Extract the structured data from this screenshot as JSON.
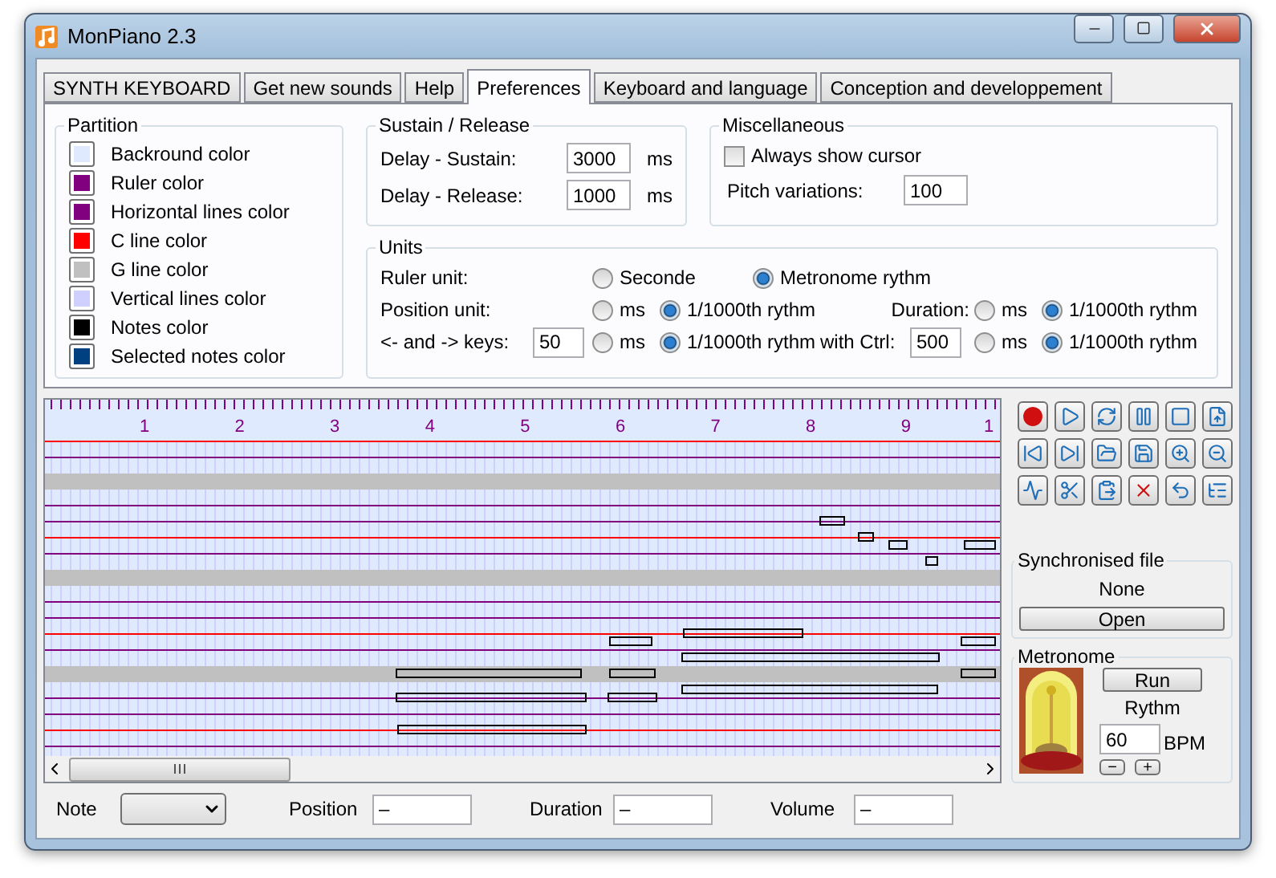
{
  "window": {
    "title": "MonPiano 2.3"
  },
  "tabs": [
    {
      "label": "SYNTH KEYBOARD",
      "selected": false
    },
    {
      "label": "Get new sounds",
      "selected": false
    },
    {
      "label": "Help",
      "selected": false
    },
    {
      "label": "Preferences",
      "selected": true
    },
    {
      "label": "Keyboard and language",
      "selected": false
    },
    {
      "label": "Conception and developpement",
      "selected": false
    }
  ],
  "partition": {
    "title": "Partition",
    "colors": [
      {
        "label": "Backround color",
        "color": "#e0eaff"
      },
      {
        "label": "Ruler color",
        "color": "#800080"
      },
      {
        "label": "Horizontal lines color",
        "color": "#800080"
      },
      {
        "label": "C line color",
        "color": "#ff0000"
      },
      {
        "label": "G line color",
        "color": "#c0c0c0"
      },
      {
        "label": "Vertical lines color",
        "color": "#d0d0ff"
      },
      {
        "label": "Notes color",
        "color": "#000000"
      },
      {
        "label": "Selected notes color",
        "color": "#004080"
      }
    ]
  },
  "sustain_release": {
    "title": "Sustain / Release",
    "fields": [
      {
        "label": "Delay - Sustain:",
        "value": "3000",
        "unit": "ms"
      },
      {
        "label": "Delay - Release:",
        "value": "1000",
        "unit": "ms"
      }
    ]
  },
  "miscellaneous": {
    "title": "Miscellaneous",
    "checkbox": {
      "label": "Always show cursor",
      "checked": false
    },
    "pitch": {
      "label": "Pitch variations:",
      "value": "100"
    }
  },
  "units": {
    "title": "Units",
    "rows": [
      {
        "kind": "single",
        "label": "Ruler unit:",
        "options": [
          {
            "label": "Seconde",
            "selected": false
          },
          {
            "label": "Metronome rythm",
            "selected": true
          }
        ]
      },
      {
        "kind": "pair",
        "label": "Position unit:",
        "options": [
          {
            "label": "ms",
            "selected": false
          },
          {
            "label": "1/1000th rythm",
            "selected": true
          }
        ],
        "second_label": "Duration:",
        "second_options": [
          {
            "label": "ms",
            "selected": false
          },
          {
            "label": "1/1000th rythm",
            "selected": true
          }
        ]
      },
      {
        "kind": "pair",
        "label": "<- and -> keys:",
        "value": "50",
        "options": [
          {
            "label": "ms",
            "selected": false
          },
          {
            "label": "1/1000th rythm",
            "selected": true
          }
        ],
        "second_label": "with Ctrl:",
        "second_value": "500",
        "second_options": [
          {
            "label": "ms",
            "selected": false
          },
          {
            "label": "1/1000th rythm",
            "selected": true
          }
        ]
      }
    ]
  },
  "ruler_labels": [
    "1",
    "2",
    "3",
    "4",
    "5",
    "6",
    "7",
    "8",
    "9",
    "1"
  ],
  "sync_file": {
    "title": "Synchronised file",
    "file": "None",
    "button": "Open"
  },
  "metronome": {
    "title": "Metronome",
    "button": "Run",
    "rythm_label": "Rythm",
    "bpm_value": "60",
    "bpm_unit": "BPM",
    "minus": "−",
    "plus": "+"
  },
  "bottom_fields": [
    {
      "kind": "dropdown",
      "label": "Note"
    },
    {
      "kind": "text",
      "label": "Position",
      "value": "–"
    },
    {
      "kind": "text",
      "label": "Duration",
      "value": "–"
    },
    {
      "kind": "text",
      "label": "Volume",
      "value": "–"
    }
  ]
}
